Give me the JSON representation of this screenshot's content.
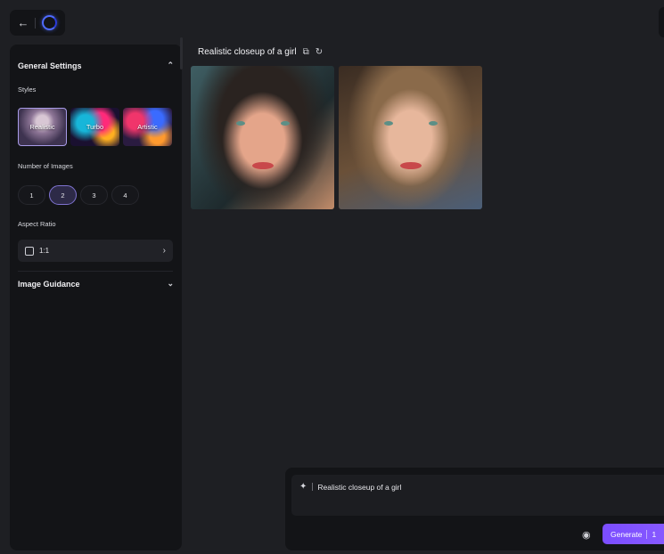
{
  "topbar": {
    "back_icon": "arrow-left-icon",
    "logo": "spinner-ring-logo"
  },
  "sidebar": {
    "general_settings": {
      "title": "General Settings",
      "expanded": true
    },
    "styles": {
      "label": "Styles",
      "items": [
        {
          "label": "Realistic",
          "selected": true
        },
        {
          "label": "Turbo",
          "selected": false
        },
        {
          "label": "Artistic",
          "selected": false
        }
      ]
    },
    "number_of_images": {
      "label": "Number of Images",
      "options": [
        "1",
        "2",
        "3",
        "4"
      ],
      "selected": "2"
    },
    "aspect_ratio": {
      "label": "Aspect Ratio",
      "value": "1:1"
    },
    "image_guidance": {
      "title": "Image Guidance",
      "expanded": false
    }
  },
  "main": {
    "result_title": "Realistic closeup of a girl",
    "images": [
      {
        "alt": "portrait-1"
      },
      {
        "alt": "portrait-2"
      }
    ]
  },
  "prompt": {
    "value": "Realistic closeup of a girl",
    "generate_label": "Generate",
    "credits": "1"
  },
  "colors": {
    "accent": "#7b4dff",
    "panel": "#131417",
    "background": "#1e1f23"
  }
}
